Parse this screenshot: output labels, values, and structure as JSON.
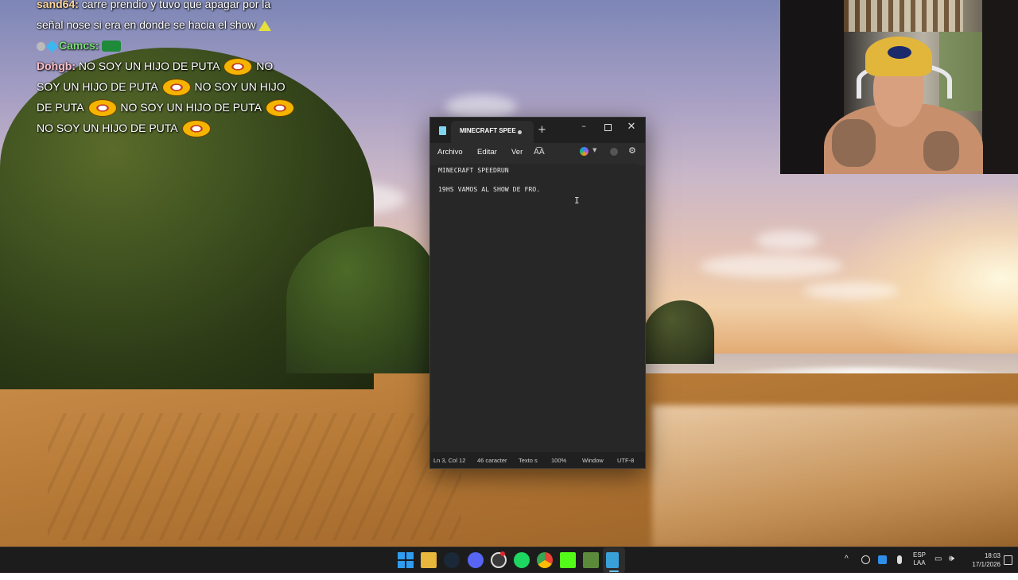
{
  "chat": {
    "line1_user": "sand64:",
    "line1_text": " carre prendio y tuvo que apagar por la señal nose si era en donde se hacia el show",
    "line2_user": "Camcs:",
    "line3_user": "Dohgb:",
    "line3_text_parts": [
      "NO SOY UN HIJO DE PUTA",
      "NO SOY UN HIJO DE PUTA",
      "NO SOY UN HIJO DE PUTA",
      "NO SOY UN HIJO DE PUTA",
      "NO SOY UN HIJO DE PUTA"
    ]
  },
  "notepad": {
    "tab_title": "MINECRAFT SPEE",
    "new_tab": "+",
    "controls": {
      "minimize": "–",
      "close": "✕"
    },
    "menu": {
      "file": "Archivo",
      "edit": "Editar",
      "view": "Ver"
    },
    "format_icon": "A͡A",
    "settings_icon": "⚙",
    "content": {
      "line1": "MINECRAFT SPEEDRUN",
      "line2": "19HS VAMOS AL SHOW DE FRO."
    },
    "cursor_glyph": "I",
    "status": {
      "position": "Ln 3, Col 12",
      "chars": "46 caracter",
      "type": "Texto s",
      "zoom": "100%",
      "line_ending": "Window",
      "encoding": "UTF-8"
    }
  },
  "taskbar": {
    "icons": [
      "windows-start-icon",
      "file-explorer-icon",
      "steam-icon",
      "discord-icon",
      "obs-icon",
      "spotify-icon",
      "chrome-icon",
      "kick-icon",
      "minecraft-icon",
      "notepad-icon"
    ],
    "tray": {
      "chevron": "^",
      "lang_line1": "ESP",
      "lang_line2": "LAA",
      "network_icon": "▭",
      "volume_icon": "🕪",
      "time": "18:03",
      "date": "17/1/2026"
    }
  },
  "colors": {
    "notepad_bg": "#272727",
    "titlebar_bg": "#202020",
    "taskbar_bg": "#1c1c1c",
    "accent": "#68c6f4"
  }
}
